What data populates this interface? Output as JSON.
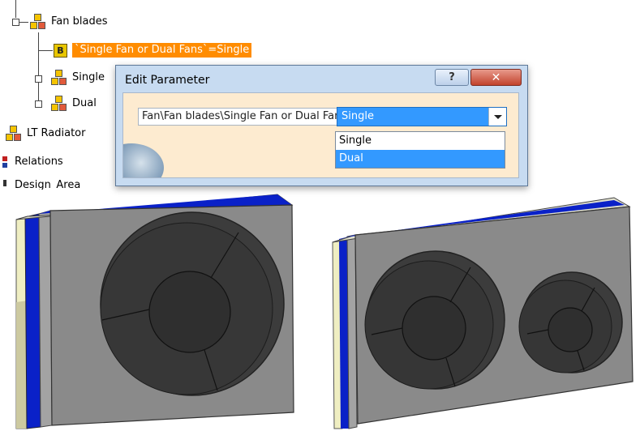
{
  "tree": {
    "items": [
      {
        "label": "Fan blades"
      },
      {
        "label": "`Single Fan or Dual Fans`=Single",
        "selected": true
      },
      {
        "label": "Single"
      },
      {
        "label": "Dual"
      },
      {
        "label": "LT Radiator"
      },
      {
        "label": "Relations"
      },
      {
        "label": "Design_Area"
      }
    ]
  },
  "dialog": {
    "title": "Edit Parameter",
    "help_label": "?",
    "close_label": "✕",
    "parameter_path": "Fan\\Fan blades\\Single Fan or Dual Fans",
    "selected_value": "Single",
    "options": [
      "Single",
      "Dual"
    ],
    "highlighted_option": "Dual"
  },
  "colors": {
    "selection_orange": "#ff8c00",
    "combo_blue": "#3399ff",
    "radiator_blue": "#0a21c8",
    "fan_dark": "#3b3b3b",
    "panel_gray": "#8a8a8a"
  },
  "icons": [
    "product-icon",
    "parameter-icon",
    "expand-icon",
    "relations-icon",
    "help-icon",
    "close-icon",
    "chevron-down-icon"
  ]
}
